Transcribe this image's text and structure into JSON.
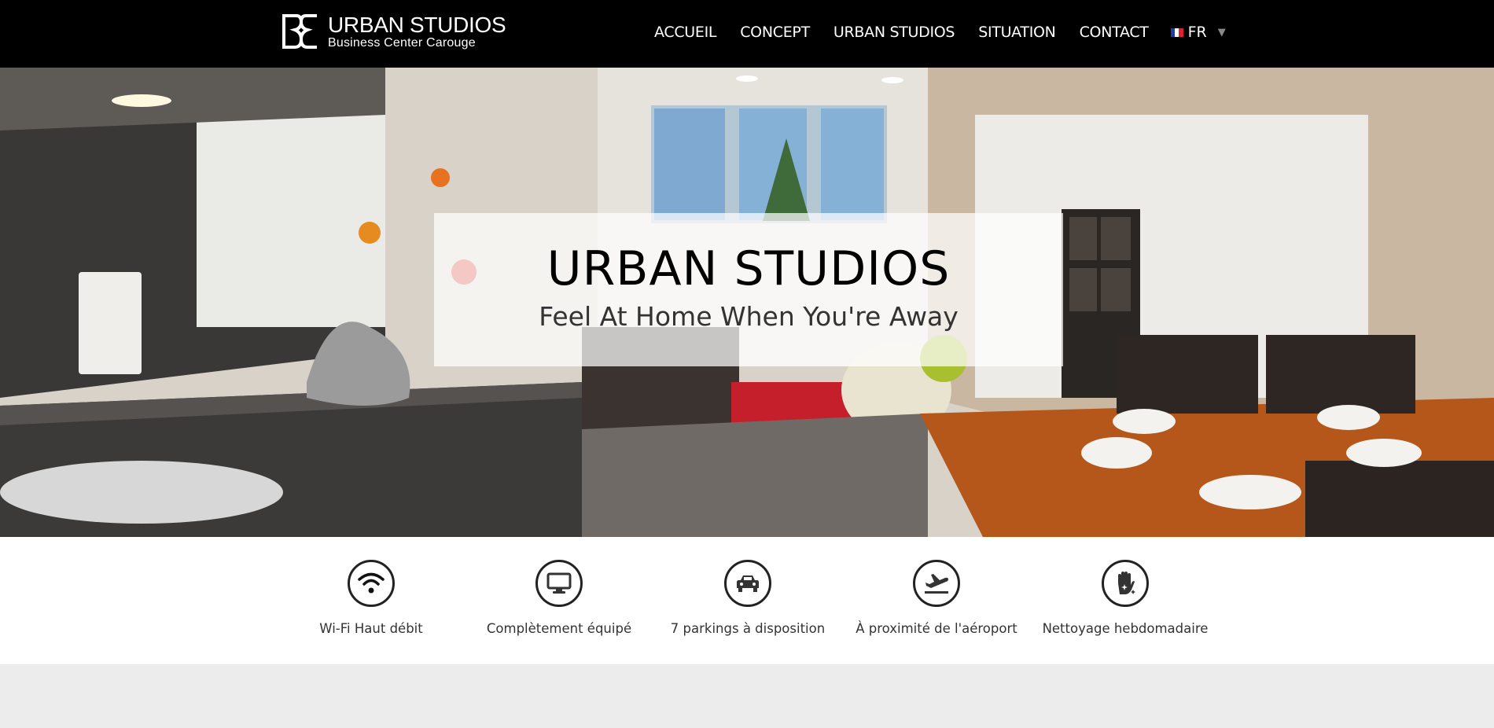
{
  "header": {
    "logo_title": "URBAN STUDIOS",
    "logo_subtitle": "Business Center Carouge",
    "nav": [
      "ACCUEIL",
      "CONCEPT",
      "URBAN STUDIOS",
      "SITUATION",
      "CONTACT"
    ],
    "language": "FR"
  },
  "hero": {
    "title": "URBAN STUDIOS",
    "subtitle": "Feel At Home When You're Away"
  },
  "features": [
    {
      "label": "Wi-Fi Haut débit",
      "icon": "wifi-icon"
    },
    {
      "label": "Complètement équipé",
      "icon": "monitor-icon"
    },
    {
      "label": "7 parkings à disposition",
      "icon": "car-icon"
    },
    {
      "label": "À proximité de l'aéroport",
      "icon": "airplane-icon"
    },
    {
      "label": "Nettoyage hebdomadaire",
      "icon": "cleaning-hand-icon"
    }
  ],
  "colors": {
    "header_bg": "#000000",
    "band_bg": "#ececec",
    "text_dark": "#333333"
  }
}
